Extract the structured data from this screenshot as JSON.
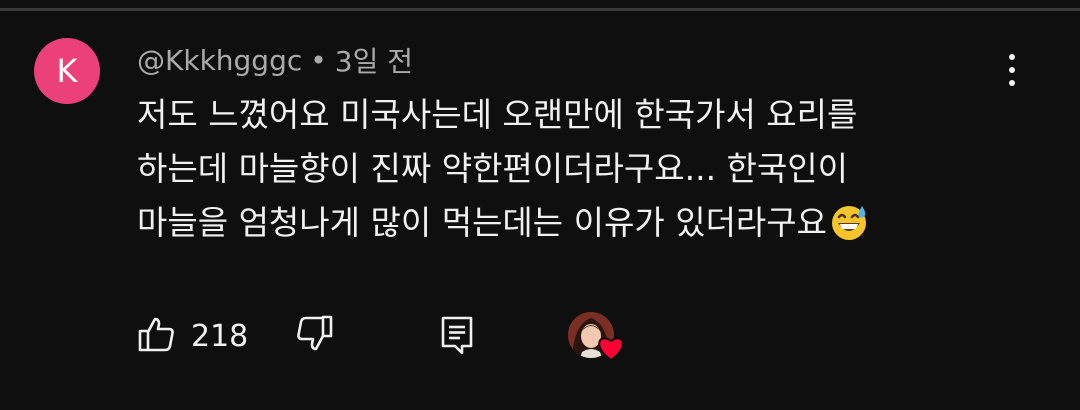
{
  "comment": {
    "avatar_letter": "K",
    "avatar_color": "#ec407a",
    "username": "@Kkkhgggc",
    "separator": "•",
    "timestamp": "3일 전",
    "text_lines": [
      "저도 느꼈어요 미국사는데 오랜만에 한국가서 요리를",
      "하는데 마늘향이 진짜 약한편이더라구요... 한국인이",
      "마늘을 엄청나게 많이 먹는데는 이유가 있더라구요"
    ],
    "emoji": "grinning-face-with-sweat-icon"
  },
  "actions": {
    "like_count": "218",
    "icons": {
      "like": "thumbs-up-icon",
      "dislike": "thumbs-down-icon",
      "reply": "reply-comment-icon",
      "heart": "heart-icon",
      "more": "more-vert-icon"
    },
    "heart_color": "#ff0033"
  },
  "colors": {
    "background": "#0f0f0f",
    "primary_text": "#f1f1f1",
    "secondary_text": "#aaaaaa"
  }
}
